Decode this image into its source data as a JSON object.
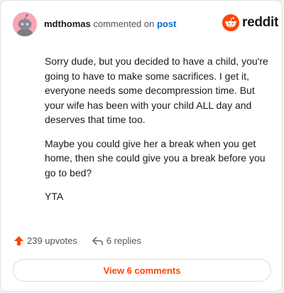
{
  "header": {
    "username": "mdthomas",
    "action_text": "commented on",
    "post_link": "post",
    "brand_name": "reddit",
    "brand_color": "#ff4500",
    "avatar_color": "#f7a6b8",
    "avatar_icon": "snoo-avatar-icon",
    "logo_icon": "reddit-snoo-icon"
  },
  "comment": {
    "paragraphs": [
      "Sorry dude, but you decided to have a child, you're going to have to make some sacrifices. I get it, everyone needs some decompression time. But your wife has been with your child ALL day and deserves that time too.",
      "Maybe you could give her a break when you get home, then she could give you a break before you go to bed?",
      "YTA"
    ]
  },
  "actions": {
    "upvotes": "239 upvotes",
    "upvote_icon": "upvote-arrow-icon",
    "replies": "6 replies",
    "reply_icon": "reply-arrow-icon"
  },
  "view_comments_label": "View 6 comments"
}
